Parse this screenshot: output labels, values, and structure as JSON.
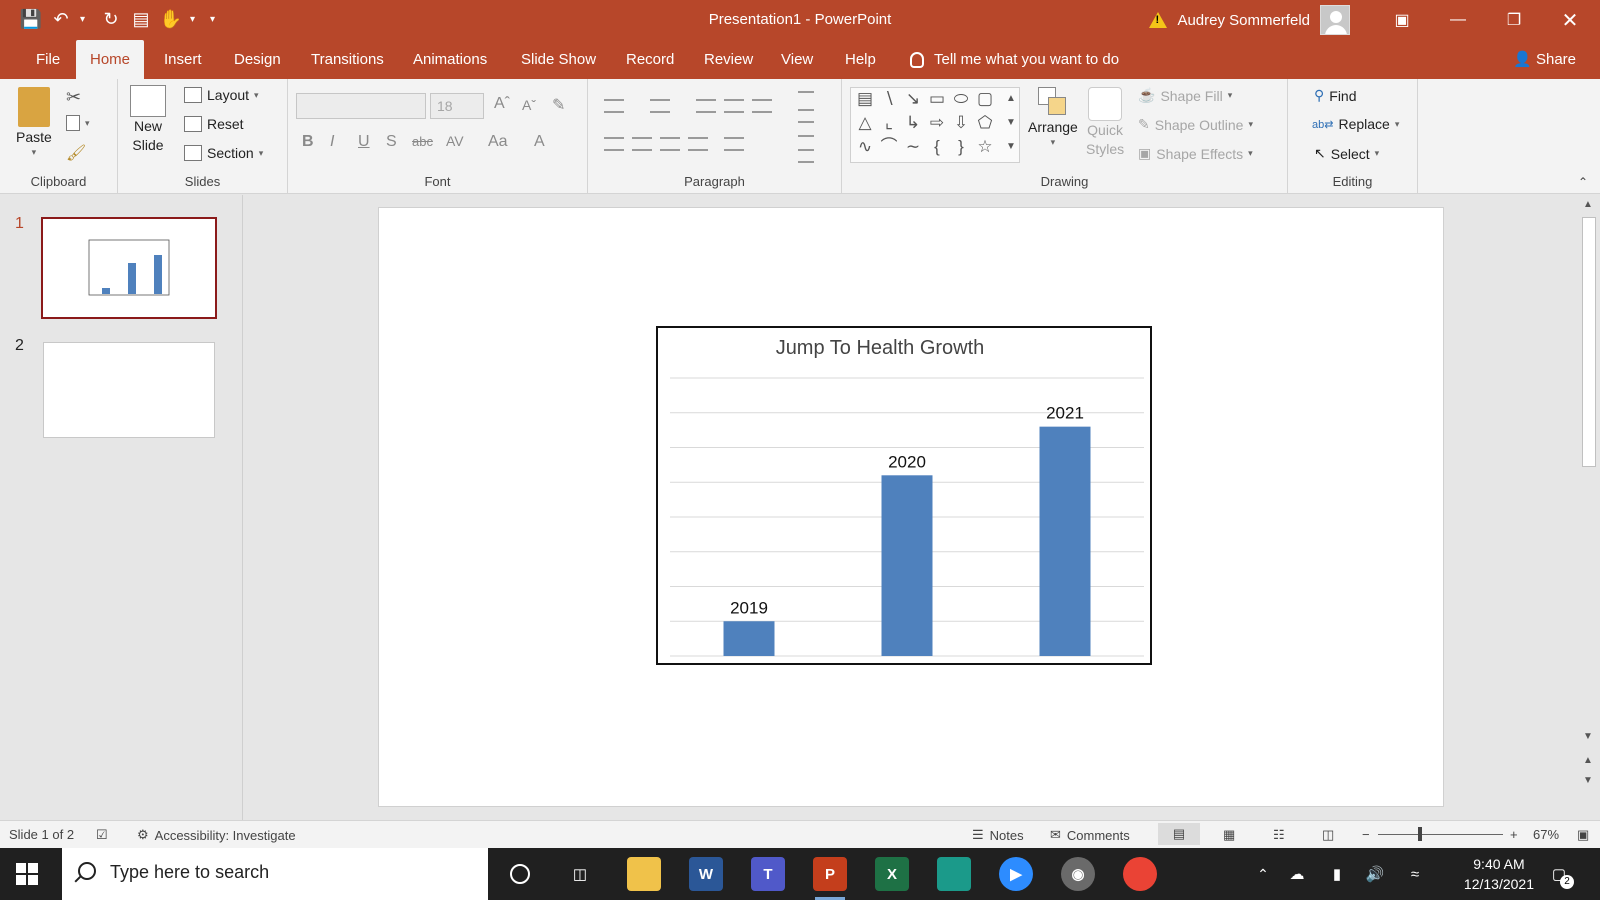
{
  "window": {
    "title": "Presentation1  -  PowerPoint",
    "user_name": "Audrey Sommerfeld"
  },
  "tabs": [
    "File",
    "Home",
    "Insert",
    "Design",
    "Transitions",
    "Animations",
    "Slide Show",
    "Record",
    "Review",
    "View",
    "Help"
  ],
  "active_tab": "Home",
  "tell_me": "Tell me what you want to do",
  "share_label": "Share",
  "ribbon": {
    "clipboard": {
      "label": "Clipboard",
      "paste": "Paste"
    },
    "slides": {
      "label": "Slides",
      "new_slide_1": "New",
      "new_slide_2": "Slide",
      "layout": "Layout",
      "reset": "Reset",
      "section": "Section"
    },
    "font": {
      "label": "Font",
      "size": "18"
    },
    "paragraph": {
      "label": "Paragraph"
    },
    "drawing": {
      "label": "Drawing",
      "arrange": "Arrange",
      "quick_styles_1": "Quick",
      "quick_styles_2": "Styles",
      "shape_fill": "Shape Fill",
      "shape_outline": "Shape Outline",
      "shape_effects": "Shape Effects"
    },
    "editing": {
      "label": "Editing",
      "find": "Find",
      "replace": "Replace",
      "select": "Select"
    }
  },
  "thumbnails": [
    {
      "number": "1",
      "selected": true
    },
    {
      "number": "2",
      "selected": false
    }
  ],
  "chart_data": {
    "type": "bar",
    "title": "Jump To Health Growth",
    "categories": [
      "2019",
      "2020",
      "2021"
    ],
    "values": [
      10,
      52,
      66
    ],
    "data_labels": [
      "2019",
      "2020",
      "2021"
    ],
    "ylim": [
      0,
      80
    ],
    "grid": true,
    "bar_color": "#4f81bd",
    "xlabel": "",
    "ylabel": ""
  },
  "status": {
    "slide_info": "Slide 1 of 2",
    "accessibility": "Accessibility: Investigate",
    "notes": "Notes",
    "comments": "Comments",
    "zoom": "67%"
  },
  "taskbar": {
    "search_placeholder": "Type here to search",
    "time": "9:40 AM",
    "date": "12/13/2021",
    "notification_count": "2"
  },
  "colors": {
    "accent": "#b7472a",
    "ribbon_bg": "#f3f3f3",
    "taskbar_bg": "#202020"
  }
}
